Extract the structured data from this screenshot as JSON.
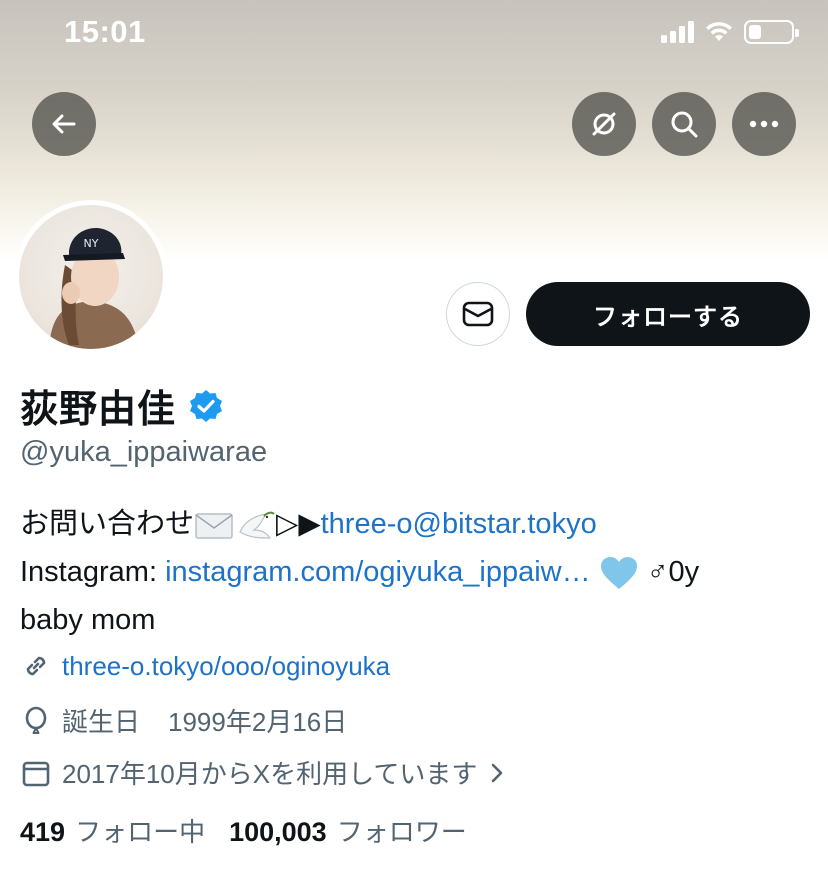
{
  "status_bar": {
    "time": "15:01"
  },
  "profile": {
    "display_name": "荻野由佳",
    "handle": "@yuka_ippaiwarae",
    "verified": true,
    "follow_label": "フォローする"
  },
  "bio": {
    "line1_text": "お問い合わせ",
    "line1_arrows": "▷▶",
    "line1_email": "three-o@bitstar.tokyo",
    "line2_prefix": "Instagram: ",
    "line2_link": "instagram.com/ogiyuka_ippaiw…",
    "line2_suffix": " ♂0y",
    "line3": "baby mom"
  },
  "meta": {
    "website": "three-o.tokyo/ooo/oginoyuka",
    "birthday_label": "誕生日",
    "birthday_value": "1999年2月16日",
    "joined": "2017年10月からXを利用しています"
  },
  "stats": {
    "following_count": "419",
    "following_label": "フォロー中",
    "followers_count": "100,003",
    "followers_label": "フォロワー"
  },
  "colors": {
    "link": "#1d73c9",
    "verified": "#1d9bf0",
    "follow_bg": "#0f1419"
  }
}
